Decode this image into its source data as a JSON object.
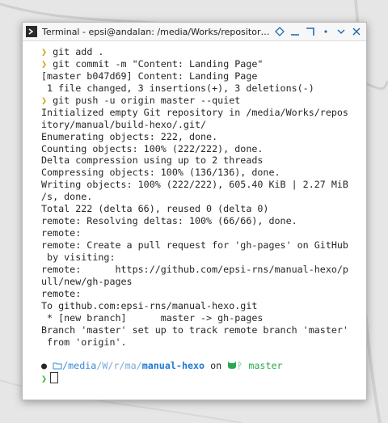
{
  "window": {
    "title": "Terminal - epsi@andalan: /media/Works/repository/manu…",
    "icons": [
      "terminal-icon",
      "diamond-icon",
      "minimize-icon",
      "maximize-icon",
      "dot-icon",
      "chevron-icon",
      "close-icon"
    ]
  },
  "terminal": {
    "lines": [
      {
        "kind": "cmd",
        "text": "git add ."
      },
      {
        "kind": "cmd",
        "text": "git commit -m \"Content: Landing Page\""
      },
      {
        "kind": "out",
        "text": "[master b047d69] Content: Landing Page"
      },
      {
        "kind": "out",
        "text": " 1 file changed, 3 insertions(+), 3 deletions(-)"
      },
      {
        "kind": "cmd",
        "text": "git push -u origin master --quiet"
      },
      {
        "kind": "out",
        "text": "Initialized empty Git repository in /media/Works/repos"
      },
      {
        "kind": "out",
        "text": "itory/manual/build-hexo/.git/"
      },
      {
        "kind": "out",
        "text": "Enumerating objects: 222, done."
      },
      {
        "kind": "out",
        "text": "Counting objects: 100% (222/222), done."
      },
      {
        "kind": "out",
        "text": "Delta compression using up to 2 threads"
      },
      {
        "kind": "out",
        "text": "Compressing objects: 100% (136/136), done."
      },
      {
        "kind": "out",
        "text": "Writing objects: 100% (222/222), 605.40 KiB | 2.27 MiB"
      },
      {
        "kind": "out",
        "text": "/s, done."
      },
      {
        "kind": "out",
        "text": "Total 222 (delta 66), reused 0 (delta 0)"
      },
      {
        "kind": "out",
        "text": "remote: Resolving deltas: 100% (66/66), done."
      },
      {
        "kind": "out",
        "text": "remote:"
      },
      {
        "kind": "out",
        "text": "remote: Create a pull request for 'gh-pages' on GitHub"
      },
      {
        "kind": "out",
        "text": " by visiting:"
      },
      {
        "kind": "out",
        "text": "remote:      https://github.com/epsi-rns/manual-hexo/p"
      },
      {
        "kind": "out",
        "text": "ull/new/gh-pages"
      },
      {
        "kind": "out",
        "text": "remote:"
      },
      {
        "kind": "out",
        "text": "To github.com:epsi-rns/manual-hexo.git"
      },
      {
        "kind": "out",
        "text": " * [new branch]      master -> gh-pages"
      },
      {
        "kind": "out",
        "text": "Branch 'master' set up to track remote branch 'master'"
      },
      {
        "kind": "out",
        "text": " from 'origin'."
      }
    ],
    "prompt_symbol": "❯",
    "status": {
      "bullet": "●",
      "path_root": "/media",
      "path_parts": [
        "W",
        "r",
        "ma"
      ],
      "path_current": "manual-hexo",
      "on_word": "on",
      "branch": "master"
    }
  },
  "colors": {
    "prompt": "#d4a017",
    "path": "#3a8bd6",
    "branch": "#2ea84e"
  }
}
